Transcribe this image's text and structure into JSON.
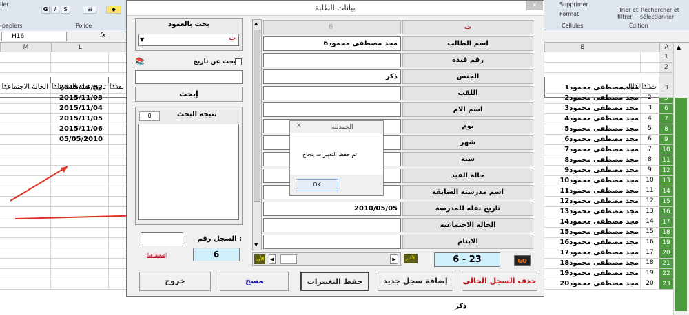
{
  "ribbon": {
    "clipboard": "-papiers",
    "police": "Police",
    "cellules": "Cellules",
    "edition": "Édition",
    "supprimer": "Supprimer",
    "format": "Format",
    "trier": "Trier et",
    "filtrer": "filtrer",
    "rechercher": "Rechercher et",
    "selectionner": "sélectionner",
    "styler": "ller"
  },
  "formula_bar": {
    "cell_ref": "H16",
    "fx": "fx"
  },
  "columns": {
    "M": "M",
    "L": "L",
    "B": "B",
    "A": "A"
  },
  "sheet_headers": {
    "col_m": "الحالة الاجتماعية",
    "col_l": "تاريخ نقله للمدرسة",
    "col_k": "بقة",
    "col_b": "اسم الطالب",
    "col_a": "ت"
  },
  "sheet_rows": [
    {
      "n": "1",
      "num": "",
      "name": "",
      "date": ""
    },
    {
      "n": "2",
      "num": "",
      "name": "",
      "date": ""
    },
    {
      "n": "3",
      "num": "",
      "name": "",
      "date": ""
    },
    {
      "n": "4",
      "num": "1",
      "name": "مجد مصطفى محمود1",
      "date": "2015/11/02"
    },
    {
      "n": "5",
      "num": "2",
      "name": "مجد مصطفى محمود2",
      "date": "2015/11/03"
    },
    {
      "n": "6",
      "num": "3",
      "name": "مجد مصطفى محمود3",
      "date": "2015/11/04"
    },
    {
      "n": "7",
      "num": "4",
      "name": "مجد مصطفى محمود4",
      "date": "2015/11/05"
    },
    {
      "n": "8",
      "num": "5",
      "name": "مجد مصطفى محمود5",
      "date": "2015/11/06"
    },
    {
      "n": "9",
      "num": "6",
      "name": "مجد مصطفى محمود6",
      "date": "05/05/2010"
    },
    {
      "n": "10",
      "num": "7",
      "name": "مجد مصطفى محمود7",
      "date": ""
    },
    {
      "n": "11",
      "num": "8",
      "name": "مجد مصطفى محمود8",
      "date": ""
    },
    {
      "n": "12",
      "num": "9",
      "name": "مجد مصطفى محمود9",
      "date": ""
    },
    {
      "n": "13",
      "num": "10",
      "name": "مجد مصطفى محمود10",
      "date": ""
    },
    {
      "n": "14",
      "num": "11",
      "name": "مجد مصطفى محمود11",
      "date": ""
    },
    {
      "n": "15",
      "num": "12",
      "name": "مجد مصطفى محمود12",
      "date": ""
    },
    {
      "n": "16",
      "num": "13",
      "name": "مجد مصطفى محمود13",
      "date": ""
    },
    {
      "n": "17",
      "num": "14",
      "name": "مجد مصطفى محمود14",
      "date": ""
    },
    {
      "n": "18",
      "num": "15",
      "name": "مجد مصطفى محمود15",
      "date": ""
    },
    {
      "n": "19",
      "num": "16",
      "name": "مجد مصطفى محمود16",
      "date": ""
    },
    {
      "n": "20",
      "num": "17",
      "name": "مجد مصطفى محمود17",
      "date": ""
    },
    {
      "n": "21",
      "num": "18",
      "name": "مجد مصطفى محمود18",
      "date": ""
    },
    {
      "n": "22",
      "num": "19",
      "name": "مجد مصطفى محمود19",
      "date": ""
    },
    {
      "n": "23",
      "num": "20",
      "name": "مجد مصطفى محمود20",
      "date": ""
    }
  ],
  "sheet_extra": {
    "gender_bottom": "ذكر"
  },
  "form": {
    "title": "بيانات الطلبة",
    "close": "×",
    "fields": [
      {
        "label": "ت",
        "value": "6"
      },
      {
        "label": "اسم الطالب",
        "value": "مجد مصطفى محمود6"
      },
      {
        "label": "رقم قيده",
        "value": ""
      },
      {
        "label": "الجنس",
        "value": "ذكر"
      },
      {
        "label": "اللقب",
        "value": ""
      },
      {
        "label": "اسم الام",
        "value": ""
      },
      {
        "label": "يوم",
        "value": ""
      },
      {
        "label": "شهر",
        "value": ""
      },
      {
        "label": "سنة",
        "value": ""
      },
      {
        "label": "حالة القيد",
        "value": ""
      },
      {
        "label": "اسم مدرسته السابقة",
        "value": ""
      },
      {
        "label": "تاريخ نقله للمدرسة",
        "value": "2010/05/05"
      },
      {
        "label": "الحالة الاجتماعية",
        "value": ""
      },
      {
        "label": "الايتام",
        "value": ""
      }
    ],
    "search_col_title": "بحث بالعمود",
    "search_col_value": "ت",
    "search_date": "البحث عن تاريخ",
    "search_btn": "إبحث",
    "result_title": "نتيجة البحث",
    "result_count": "0",
    "record_label": "السجل رقم :",
    "record_value": "6",
    "press_here": "إضغط هنا",
    "nav_first": "الأول",
    "nav_last": "الأخير",
    "nav_count": "6 - 23",
    "go": "GO",
    "btn_delete": "حذف السجل الحالي",
    "btn_add": "إضافة سجل جديد",
    "btn_save": "حفظ التغييرات",
    "btn_clear": "مسح",
    "btn_exit": "خروج"
  },
  "msgbox": {
    "title": "الحمدلله",
    "text": "تم حفظ التغييرات بنجاح",
    "ok": "OK",
    "close": "×"
  },
  "colors": {
    "accent_red": "#c0121a",
    "green_sel": "#4e9a3f",
    "cyan_field": "#cfeffb"
  }
}
